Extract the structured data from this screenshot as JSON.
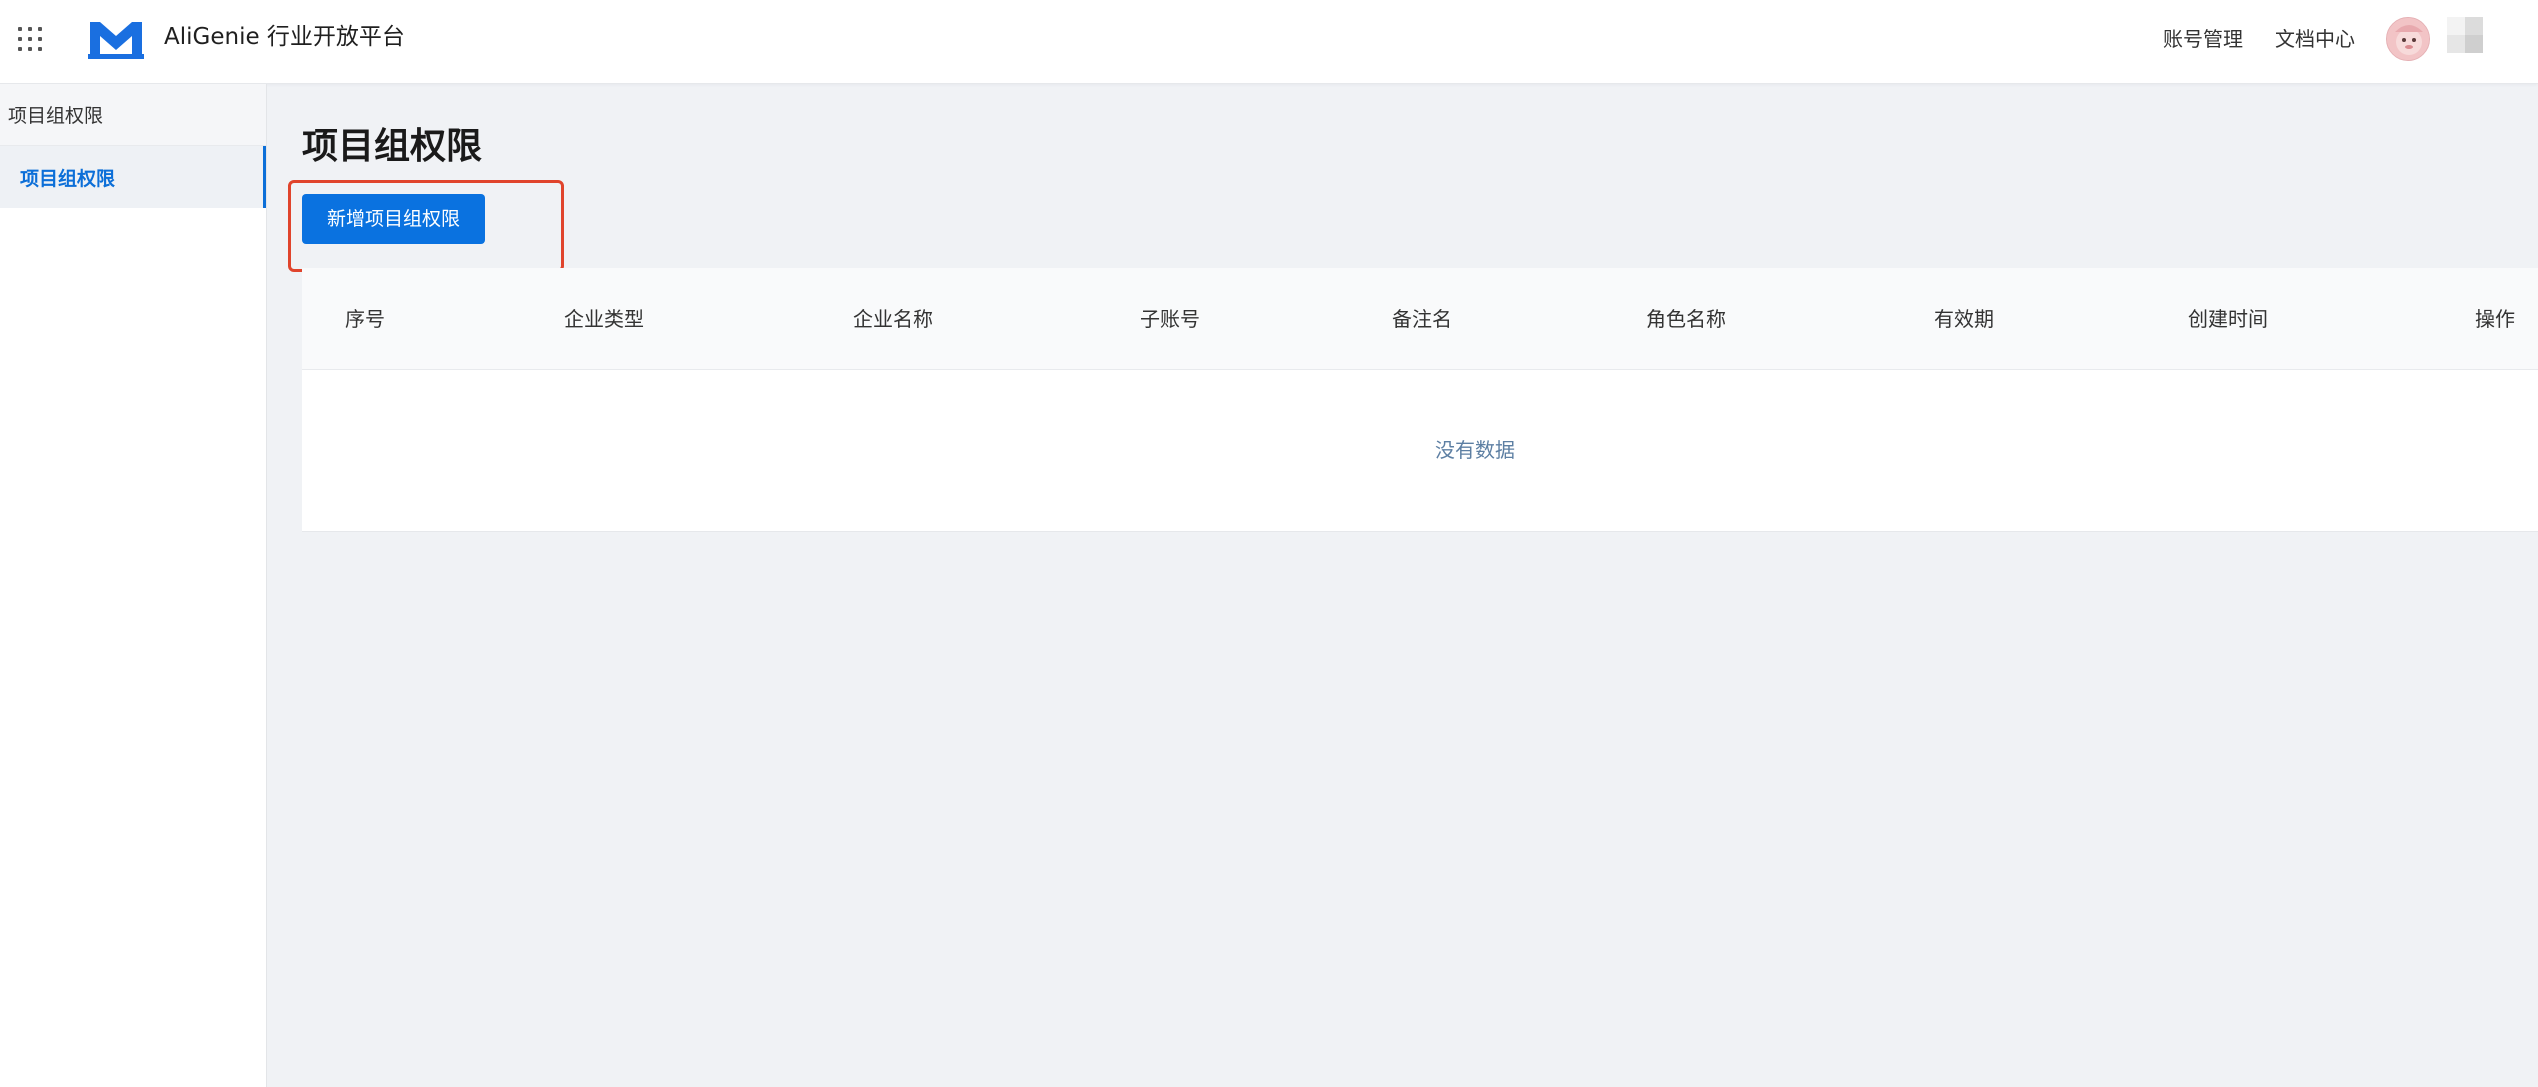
{
  "header": {
    "brand": "AliGenie 行业开放平台",
    "nav": [
      "账号管理",
      "文档中心"
    ],
    "brand_color": "#1a6fe0"
  },
  "sidebar": {
    "group_label": "项目组权限",
    "items": [
      {
        "label": "项目组权限",
        "active": true
      }
    ],
    "accent": "#0c6fd8"
  },
  "main": {
    "title": "项目组权限",
    "add_button": "新增项目组权限",
    "highlight_color": "#e0442c",
    "table": {
      "columns": [
        "序号",
        "企业类型",
        "企业名称",
        "子账号",
        "备注名",
        "角色名称",
        "有效期",
        "创建时间",
        "操作"
      ],
      "rows": [],
      "empty_text": "没有数据"
    }
  }
}
